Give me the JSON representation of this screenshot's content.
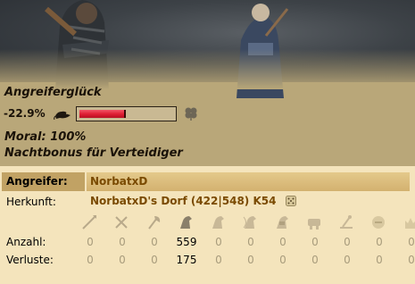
{
  "luck": {
    "title": "Angreiferglück",
    "percent_text": "-22.9%",
    "value_percent": -22.9,
    "bad_icon": "bad-luck-rat-icon",
    "good_icon": "good-luck-clover-icon",
    "bar_color": "#e02035"
  },
  "moral": "Moral: 100%",
  "night_bonus": "Nachtbonus für Verteidiger",
  "attacker": {
    "label": "Angreifer:",
    "player": "NorbatxD",
    "origin_label": "Herkunft:",
    "origin_village": "NorbatxD's Dorf (422|548) K54",
    "origin_icon": "dice-icon",
    "units": [
      {
        "name": "spear-icon"
      },
      {
        "name": "sword-icon"
      },
      {
        "name": "axe-icon"
      },
      {
        "name": "scout-icon"
      },
      {
        "name": "light-cavalry-icon"
      },
      {
        "name": "mounted-archer-icon"
      },
      {
        "name": "heavy-cavalry-icon"
      },
      {
        "name": "ram-icon"
      },
      {
        "name": "catapult-icon"
      },
      {
        "name": "paladin-icon"
      },
      {
        "name": "nobleman-icon"
      }
    ],
    "count_label": "Anzahl:",
    "counts": [
      "0",
      "0",
      "0",
      "559",
      "0",
      "0",
      "0",
      "0",
      "0",
      "0",
      "0"
    ],
    "loss_label": "Verluste:",
    "losses": [
      "0",
      "0",
      "0",
      "175",
      "0",
      "0",
      "0",
      "0",
      "0",
      "0",
      "0"
    ]
  }
}
